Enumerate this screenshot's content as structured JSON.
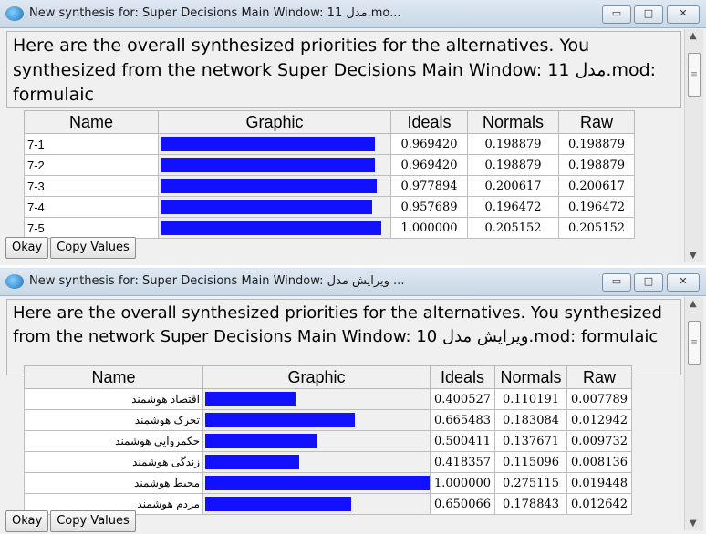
{
  "window1": {
    "title": "New synthesis for: Super Decisions Main Window: 11 مدل.mo...",
    "message": "Here are the overall synthesized priorities for the alternatives.  You synthesized from the network Super Decisions Main Window: 11 مدل.mod: formulaic",
    "columns": [
      "Name",
      "Graphic",
      "Ideals",
      "Normals",
      "Raw"
    ],
    "rows": [
      {
        "name": "7-1",
        "ideal": "0.969420",
        "normal": "0.198879",
        "raw": "0.198879",
        "bar": 0.96942
      },
      {
        "name": "7-2",
        "ideal": "0.969420",
        "normal": "0.198879",
        "raw": "0.198879",
        "bar": 0.96942
      },
      {
        "name": "7-3",
        "ideal": "0.977894",
        "normal": "0.200617",
        "raw": "0.200617",
        "bar": 0.977894
      },
      {
        "name": "7-4",
        "ideal": "0.957689",
        "normal": "0.196472",
        "raw": "0.196472",
        "bar": 0.957689
      },
      {
        "name": "7-5",
        "ideal": "1.000000",
        "normal": "0.205152",
        "raw": "0.205152",
        "bar": 1.0
      }
    ],
    "okay_label": "Okay",
    "copy_label": "Copy Values"
  },
  "window2": {
    "title": "New synthesis for: Super Decisions Main Window: ویرایش مدل ...",
    "message": "Here are the overall synthesized priorities for the alternatives.  You synthesized from the network Super Decisions Main Window: 10 ویرایش مدل.mod: formulaic",
    "columns": [
      "Name",
      "Graphic",
      "Ideals",
      "Normals",
      "Raw"
    ],
    "rows": [
      {
        "name": "اقتصاد هوشمند",
        "ideal": "0.400527",
        "normal": "0.110191",
        "raw": "0.007789",
        "bar": 0.400527
      },
      {
        "name": "تحرک هوشمند",
        "ideal": "0.665483",
        "normal": "0.183084",
        "raw": "0.012942",
        "bar": 0.665483
      },
      {
        "name": "حکمروایی هوشمند",
        "ideal": "0.500411",
        "normal": "0.137671",
        "raw": "0.009732",
        "bar": 0.500411
      },
      {
        "name": "زندگی هوشمند",
        "ideal": "0.418357",
        "normal": "0.115096",
        "raw": "0.008136",
        "bar": 0.418357
      },
      {
        "name": "محیط هوشمند",
        "ideal": "1.000000",
        "normal": "0.275115",
        "raw": "0.019448",
        "bar": 1.0
      },
      {
        "name": "مردم هوشمند",
        "ideal": "0.650066",
        "normal": "0.178843",
        "raw": "0.012642",
        "bar": 0.650066
      }
    ],
    "okay_label": "Okay",
    "copy_label": "Copy Values"
  },
  "window_buttons": {
    "minimize": "▭",
    "maximize": "□",
    "close": "✕"
  },
  "colors": {
    "bar": "#1111ff"
  }
}
